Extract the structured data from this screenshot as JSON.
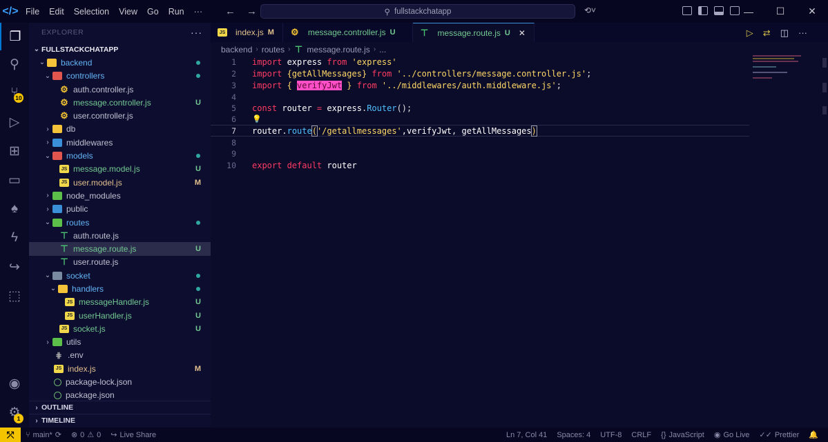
{
  "titlebar": {
    "menu": [
      "File",
      "Edit",
      "Selection",
      "View",
      "Go",
      "Run"
    ],
    "more": "···",
    "search": "fullstackchatapp"
  },
  "activity": {
    "scm_badge": "10",
    "settings_badge": "1"
  },
  "sidebar": {
    "header": "EXPLORER",
    "more": "···",
    "root": "FULLSTACKCHATAPP",
    "outline": "OUTLINE",
    "timeline": "TIMELINE",
    "tree": [
      {
        "label": "backend",
        "status": "dot"
      },
      {
        "label": "controllers",
        "status": "dot"
      },
      {
        "label": "auth.controller.js",
        "status": ""
      },
      {
        "label": "message.controller.js",
        "status": "U"
      },
      {
        "label": "user.controller.js",
        "status": ""
      },
      {
        "label": "db",
        "status": ""
      },
      {
        "label": "middlewares",
        "status": ""
      },
      {
        "label": "models",
        "status": "dot"
      },
      {
        "label": "message.model.js",
        "status": "U"
      },
      {
        "label": "user.model.js",
        "status": "M"
      },
      {
        "label": "node_modules",
        "status": ""
      },
      {
        "label": "public",
        "status": ""
      },
      {
        "label": "routes",
        "status": "dot"
      },
      {
        "label": "auth.route.js",
        "status": ""
      },
      {
        "label": "message.route.js",
        "status": "U"
      },
      {
        "label": "user.route.js",
        "status": ""
      },
      {
        "label": "socket",
        "status": "dot"
      },
      {
        "label": "handlers",
        "status": "dot"
      },
      {
        "label": "messageHandler.js",
        "status": "U"
      },
      {
        "label": "userHandler.js",
        "status": "U"
      },
      {
        "label": "socket.js",
        "status": "U"
      },
      {
        "label": "utils",
        "status": ""
      },
      {
        "label": ".env",
        "status": ""
      },
      {
        "label": "index.js",
        "status": "M"
      },
      {
        "label": "package-lock.json",
        "status": ""
      },
      {
        "label": "package.json",
        "status": ""
      }
    ]
  },
  "tabs": [
    {
      "label": "index.js",
      "state": "M"
    },
    {
      "label": "message.controller.js",
      "state": "U"
    },
    {
      "label": "message.route.js",
      "state": "U"
    }
  ],
  "breadcrumb": [
    "backend",
    "routes",
    "message.route.js",
    "..."
  ],
  "editor": {
    "line_numbers": [
      "1",
      "2",
      "3",
      "4",
      "5",
      "6",
      "7",
      "8",
      "9",
      "10"
    ],
    "code": {
      "l1": [
        "import",
        " express ",
        "from",
        " 'express'"
      ],
      "l2": [
        "import",
        " {getAllMessages} ",
        "from",
        " '../controllers/message.controller.js'",
        ";"
      ],
      "l3": [
        "import",
        " { ",
        "verifyJwt",
        " } ",
        "from",
        " '../middlewares/auth.middleware.js'",
        ";"
      ],
      "l5": [
        "const",
        " router ",
        "=",
        " express",
        ".",
        "Router",
        "();"
      ],
      "l7": [
        "router",
        ".",
        "route",
        "(",
        "'/getallmessages'",
        ",verifyJwt",
        ",",
        " getAllMessages",
        ")"
      ],
      "l10": [
        "export",
        " default",
        " router"
      ]
    }
  },
  "statusbar": {
    "branch": "main*",
    "errors": "0",
    "warnings": "0",
    "live_share": "Live Share",
    "position": "Ln 7, Col 41",
    "spaces": "Spaces: 4",
    "encoding": "UTF-8",
    "eol": "CRLF",
    "language": "JavaScript",
    "go_live": "Go Live",
    "prettier": "Prettier"
  }
}
